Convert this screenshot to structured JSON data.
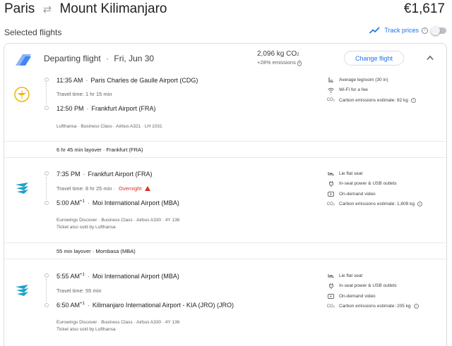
{
  "header": {
    "origin": "Paris",
    "destination": "Mount Kilimanjaro",
    "price": "€1,617"
  },
  "selected_flights_label": "Selected flights",
  "track_prices": {
    "label": "Track prices",
    "info_glyph": "i",
    "enabled": false
  },
  "departing": {
    "title": "Departing flight",
    "date": "Fri, Jun 30",
    "emissions_value": "2,096 kg CO",
    "emissions_sub": "2",
    "emissions_delta": "+28% emissions",
    "change_label": "Change flight"
  },
  "segments": [
    {
      "airline_icon": "lufthansa-logo",
      "dep_time": "11:35 AM",
      "dep_time_sup": "",
      "dep_airport": "Paris Charles de Gaulle Airport (CDG)",
      "travel_time": "Travel time: 1 hr 15 min",
      "overnight": "",
      "arr_time": "12:50 PM",
      "arr_time_sup": "",
      "arr_airport": "Frankfurt Airport (FRA)",
      "details": "Lufthansa · Business Class · Airbus A321 · LH 1031",
      "sold_by": "",
      "amenities": [
        {
          "icon": "legroom-icon",
          "text": "Average legroom (30 in)"
        },
        {
          "icon": "wifi-icon",
          "text": "Wi-Fi for a fee"
        },
        {
          "icon": "co2-icon",
          "text": "Carbon emissions estimate: 82 kg"
        }
      ]
    },
    {
      "airline_icon": "eurowings-logo",
      "dep_time": "7:35 PM",
      "dep_time_sup": "",
      "dep_airport": "Frankfurt Airport (FRA)",
      "travel_time": "Travel time: 8 hr 25 min",
      "overnight": "Overnight",
      "arr_time": "5:00 AM",
      "arr_time_sup": "+1",
      "arr_airport": "Moi International Airport (MBA)",
      "details": "Eurowings Discover · Business Class · Airbus A330 · 4Y 136",
      "sold_by": "Ticket also sold by Lufthansa",
      "amenities": [
        {
          "icon": "seat-icon",
          "text": "Lie flat seat"
        },
        {
          "icon": "power-icon",
          "text": "In-seat power & USB outlets"
        },
        {
          "icon": "video-icon",
          "text": "On-demand video"
        },
        {
          "icon": "co2-icon",
          "text": "Carbon emissions estimate: 1,808 kg"
        }
      ]
    },
    {
      "airline_icon": "eurowings-logo",
      "dep_time": "5:55 AM",
      "dep_time_sup": "+1",
      "dep_airport": "Moi International Airport (MBA)",
      "travel_time": "Travel time: 55 min",
      "overnight": "",
      "arr_time": "6:50 AM",
      "arr_time_sup": "+1",
      "arr_airport": "Kilimanjaro International Airport - KIA (JRO) (JRO)",
      "details": "Eurowings Discover · Business Class · Airbus A330 · 4Y 136",
      "sold_by": "Ticket also sold by Lufthansa",
      "amenities": [
        {
          "icon": "seat-icon",
          "text": "Lie flat seat"
        },
        {
          "icon": "power-icon",
          "text": "In-seat power & USB outlets"
        },
        {
          "icon": "video-icon",
          "text": "On-demand video"
        },
        {
          "icon": "co2-icon",
          "text": "Carbon emissions estimate: 205 kg"
        }
      ]
    }
  ],
  "layovers": [
    "6 hr 45 min layover · Frankfurt (FRA)",
    "55 min layover · Mombasa (MBA)"
  ],
  "colors": {
    "accent": "#1a73e8",
    "warning": "#d93025",
    "lufthansa": "#f2b500",
    "eurowings": "#1aa3c7"
  }
}
